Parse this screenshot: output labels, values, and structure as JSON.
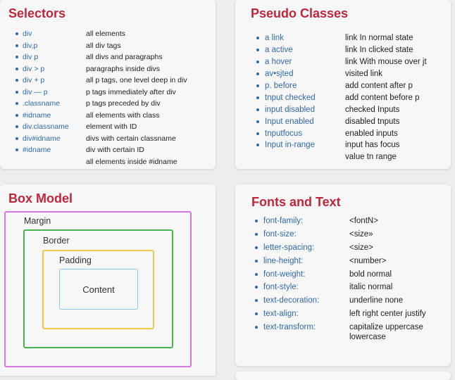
{
  "selectors": {
    "title": "Selectors",
    "items": [
      {
        "term": "div",
        "desc": "all elements"
      },
      {
        "term": "div,p",
        "desc": "all div tags"
      },
      {
        "term": "div p",
        "desc": "all divs and paragraphs"
      },
      {
        "term": "div > p",
        "desc": "paragraphs inside divs"
      },
      {
        "term": "div + p",
        "desc": "all p tags, one level deep in div"
      },
      {
        "term": "div — p",
        "desc": "p tags immediately after div"
      },
      {
        "term": ".classname",
        "desc": "p tags preceded by div"
      },
      {
        "term": "#idname",
        "desc": "all elements with class"
      },
      {
        "term": "div.classname",
        "desc": "element with ID"
      },
      {
        "term": "div#idname",
        "desc": "divs with certain classname"
      },
      {
        "term": "#idname",
        "desc": "div with certain ID"
      },
      {
        "term": "",
        "desc": "all elements inside #idname"
      }
    ]
  },
  "pseudo": {
    "title": "Pseudo Classes",
    "items": [
      {
        "term": "a link",
        "desc": "link In normal state"
      },
      {
        "term": "a active",
        "desc": "link In clicked state"
      },
      {
        "term": "a hover",
        "desc": "link With mouse over jt"
      },
      {
        "term": "av•sjted",
        "desc": "visited link"
      },
      {
        "term": "p. before",
        "desc": "add content after p"
      },
      {
        "term": "tnput checked",
        "desc": "add content before p"
      },
      {
        "term": "input disabled",
        "desc": "checked Inputs"
      },
      {
        "term": "Input enabled",
        "desc": "disabled tnputs"
      },
      {
        "term": "tnputfocus",
        "desc": "enabled inputs"
      },
      {
        "term": "Input in-range",
        "desc": "input has focus"
      },
      {
        "term": "",
        "desc": "value tn range"
      }
    ]
  },
  "box_model": {
    "title": "Box Model",
    "margin_label": "Margin",
    "border_label": "Border",
    "padding_label": "Padding",
    "content_label": "Content",
    "colors": {
      "margin": "#d877e3",
      "border": "#48b44d",
      "padding": "#f0c94a",
      "content": "#8cc9e4"
    }
  },
  "fonts": {
    "title": "Fonts and Text",
    "items": [
      {
        "term": "font-family:",
        "desc": "<fontN>"
      },
      {
        "term": "font-size:",
        "desc": "<size»"
      },
      {
        "term": "letter-spacing:",
        "desc": "<size>"
      },
      {
        "term": "line-height:",
        "desc": "<number>"
      },
      {
        "term": "font-weight:",
        "desc": "bold normal"
      },
      {
        "term": "font-style:",
        "desc": "italic normal"
      },
      {
        "term": "text-decoration:",
        "desc": "underline none"
      },
      {
        "term": "text-align:",
        "desc": "left right center justify"
      },
      {
        "term": "text-transform:",
        "desc": "capitalize uppercase",
        "desc2": "lowercase"
      }
    ]
  },
  "theme": {
    "title_color": "#c0263b",
    "term_color": "#2e6aa8"
  }
}
